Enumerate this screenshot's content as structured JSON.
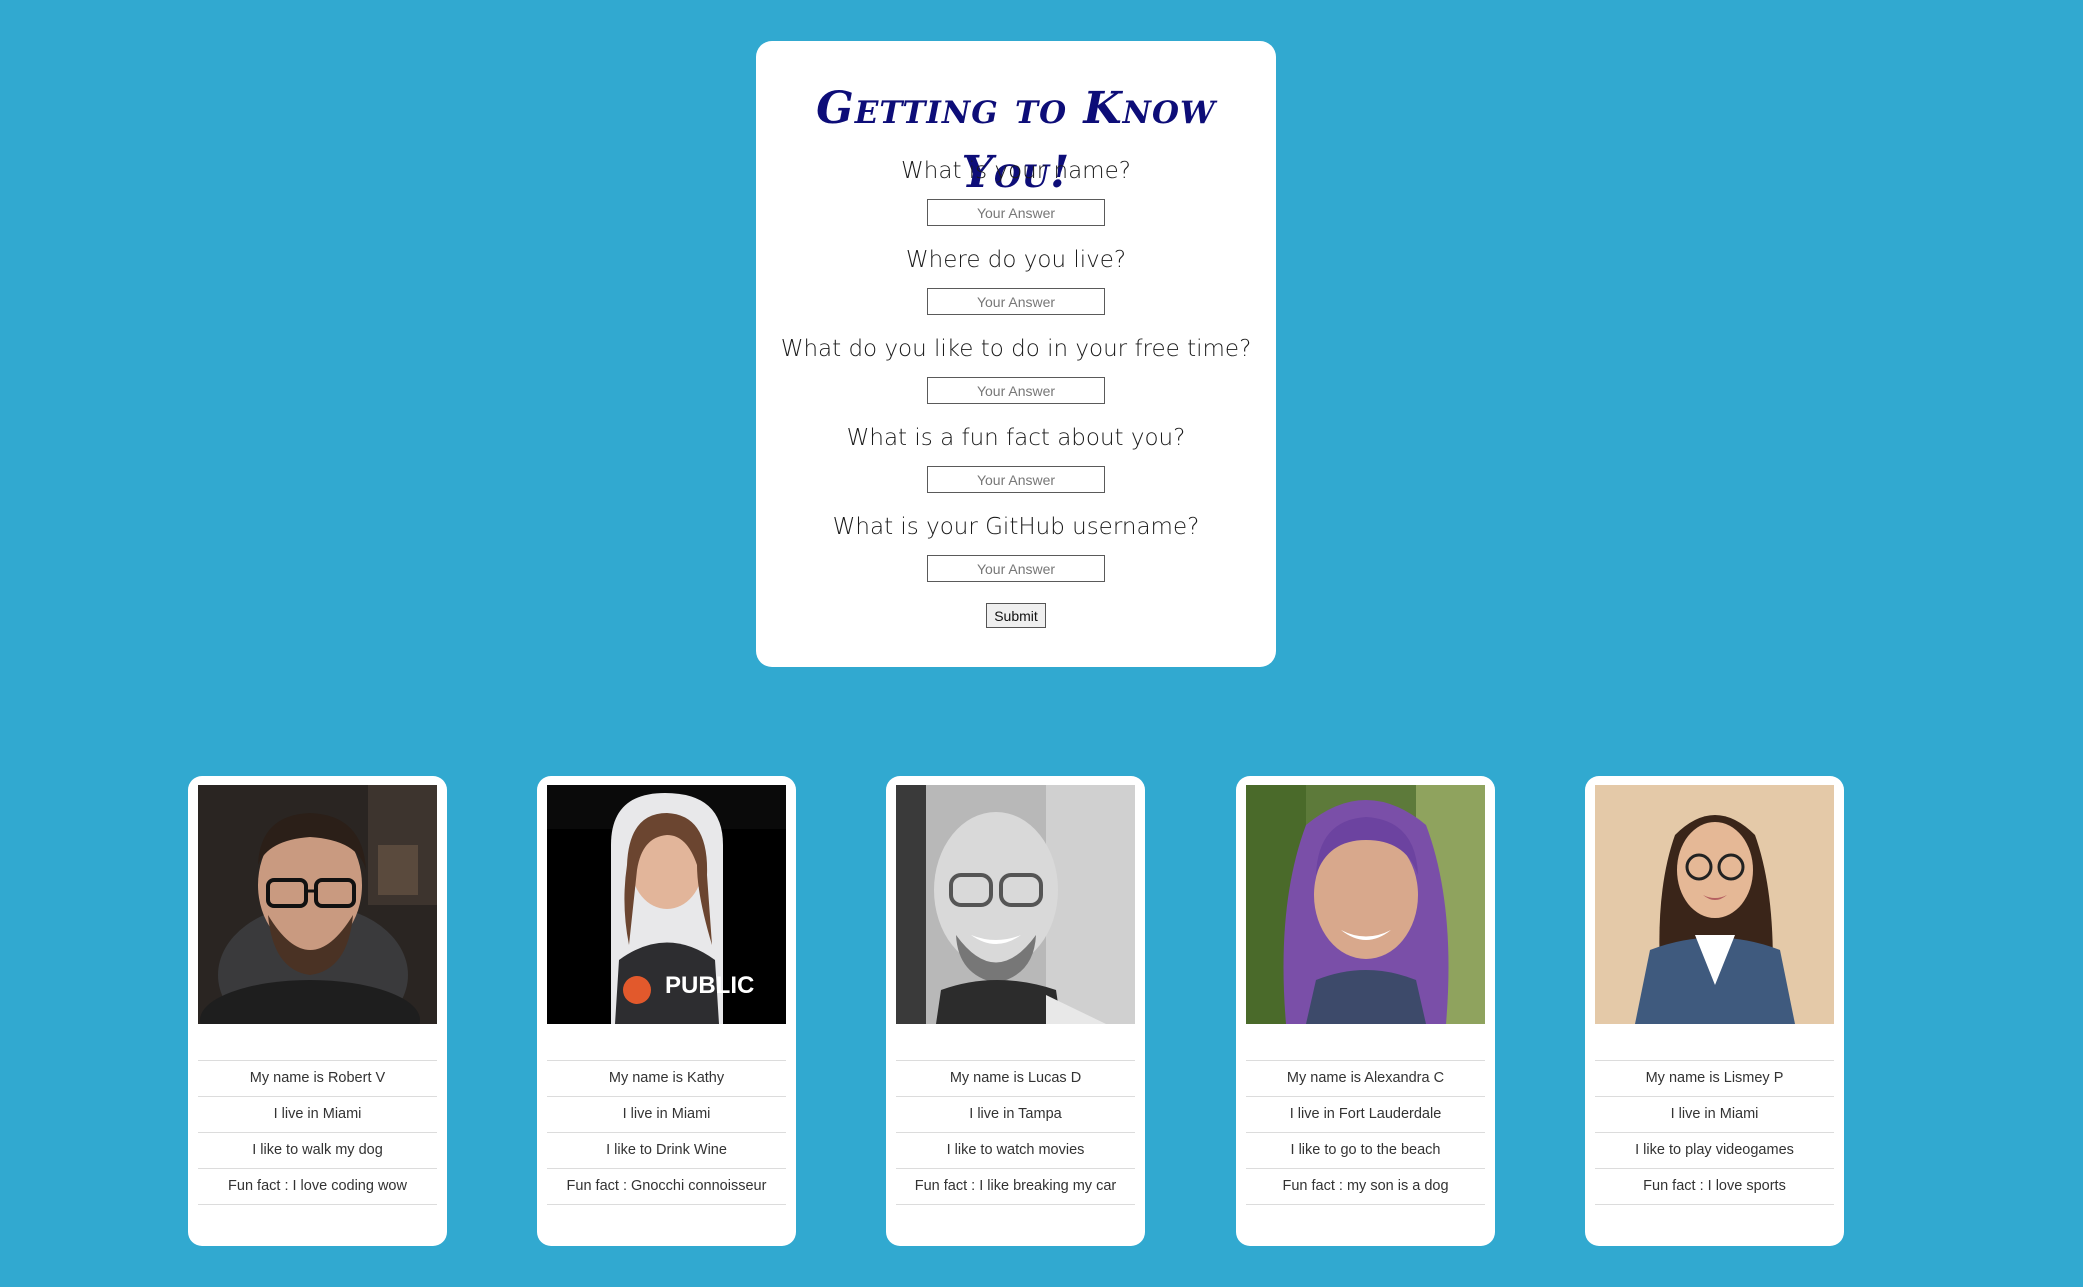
{
  "form": {
    "title": "Getting to Know You!",
    "questions": [
      {
        "label": "What is your name?",
        "placeholder": "Your Answer",
        "value": ""
      },
      {
        "label": "Where do you live?",
        "placeholder": "Your Answer",
        "value": ""
      },
      {
        "label": "What do you like to do in your free time?",
        "placeholder": "Your Answer",
        "value": ""
      },
      {
        "label": "What is a fun fact about you?",
        "placeholder": "Your Answer",
        "value": ""
      },
      {
        "label": "What is your GitHub username?",
        "placeholder": "Your Answer",
        "value": ""
      }
    ],
    "submit_label": "Submit"
  },
  "profiles": [
    {
      "name_line": "My name is Robert V",
      "live_line": "I live in Miami",
      "hobby_line": "I like to walk my dog",
      "fact_line": "Fun fact : I love coding wow"
    },
    {
      "name_line": "My name is Kathy",
      "live_line": "I live in Miami",
      "hobby_line": "I like to Drink Wine",
      "fact_line": "Fun fact : Gnocchi connoisseur"
    },
    {
      "name_line": "My name is Lucas D",
      "live_line": "I live in Tampa",
      "hobby_line": "I like to watch movies",
      "fact_line": "Fun fact : I like breaking my car"
    },
    {
      "name_line": "My name is Alexandra C",
      "live_line": "I live in Fort Lauderdale",
      "hobby_line": "I like to go to the beach",
      "fact_line": "Fun fact : my son is a dog"
    },
    {
      "name_line": "My name is Lismey P",
      "live_line": "I live in Miami",
      "hobby_line": "I like to play videogames",
      "fact_line": "Fun fact : I love sports"
    }
  ],
  "colors": {
    "page_background": "#31a9d0",
    "card_background": "#ffffff",
    "title_color": "#0d0d78"
  }
}
